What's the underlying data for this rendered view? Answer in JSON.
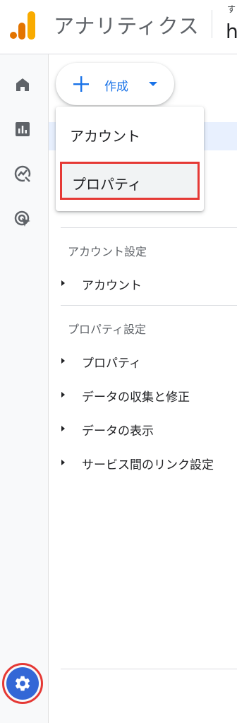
{
  "header": {
    "app_title": "アナリティクス",
    "account_line_top": "す",
    "account_line_bottom": "h",
    "logo_colors": [
      "#f9ab00",
      "#e37400"
    ]
  },
  "rail": {
    "items": [
      {
        "name": "home",
        "icon": "home-icon"
      },
      {
        "name": "reports",
        "icon": "bar-chart-icon"
      },
      {
        "name": "explore",
        "icon": "explore-icon"
      },
      {
        "name": "advertising",
        "icon": "ads-cursor-icon"
      }
    ],
    "settings": {
      "icon": "gear-icon"
    }
  },
  "create": {
    "label": "作成",
    "menu": [
      {
        "label": "アカウント"
      },
      {
        "label": "プロパティ",
        "highlighted": true
      }
    ]
  },
  "sections": [
    {
      "title": "アカウント設定",
      "items": [
        {
          "label": "アカウント"
        }
      ]
    },
    {
      "title": "プロパティ設定",
      "items": [
        {
          "label": "プロパティ"
        },
        {
          "label": "データの収集と修正"
        },
        {
          "label": "データの表示"
        },
        {
          "label": "サービス間のリンク設定"
        }
      ]
    }
  ],
  "colors": {
    "accent": "#1a73e8",
    "highlight_outline": "#e53935",
    "settings_button": "#3367d6"
  }
}
